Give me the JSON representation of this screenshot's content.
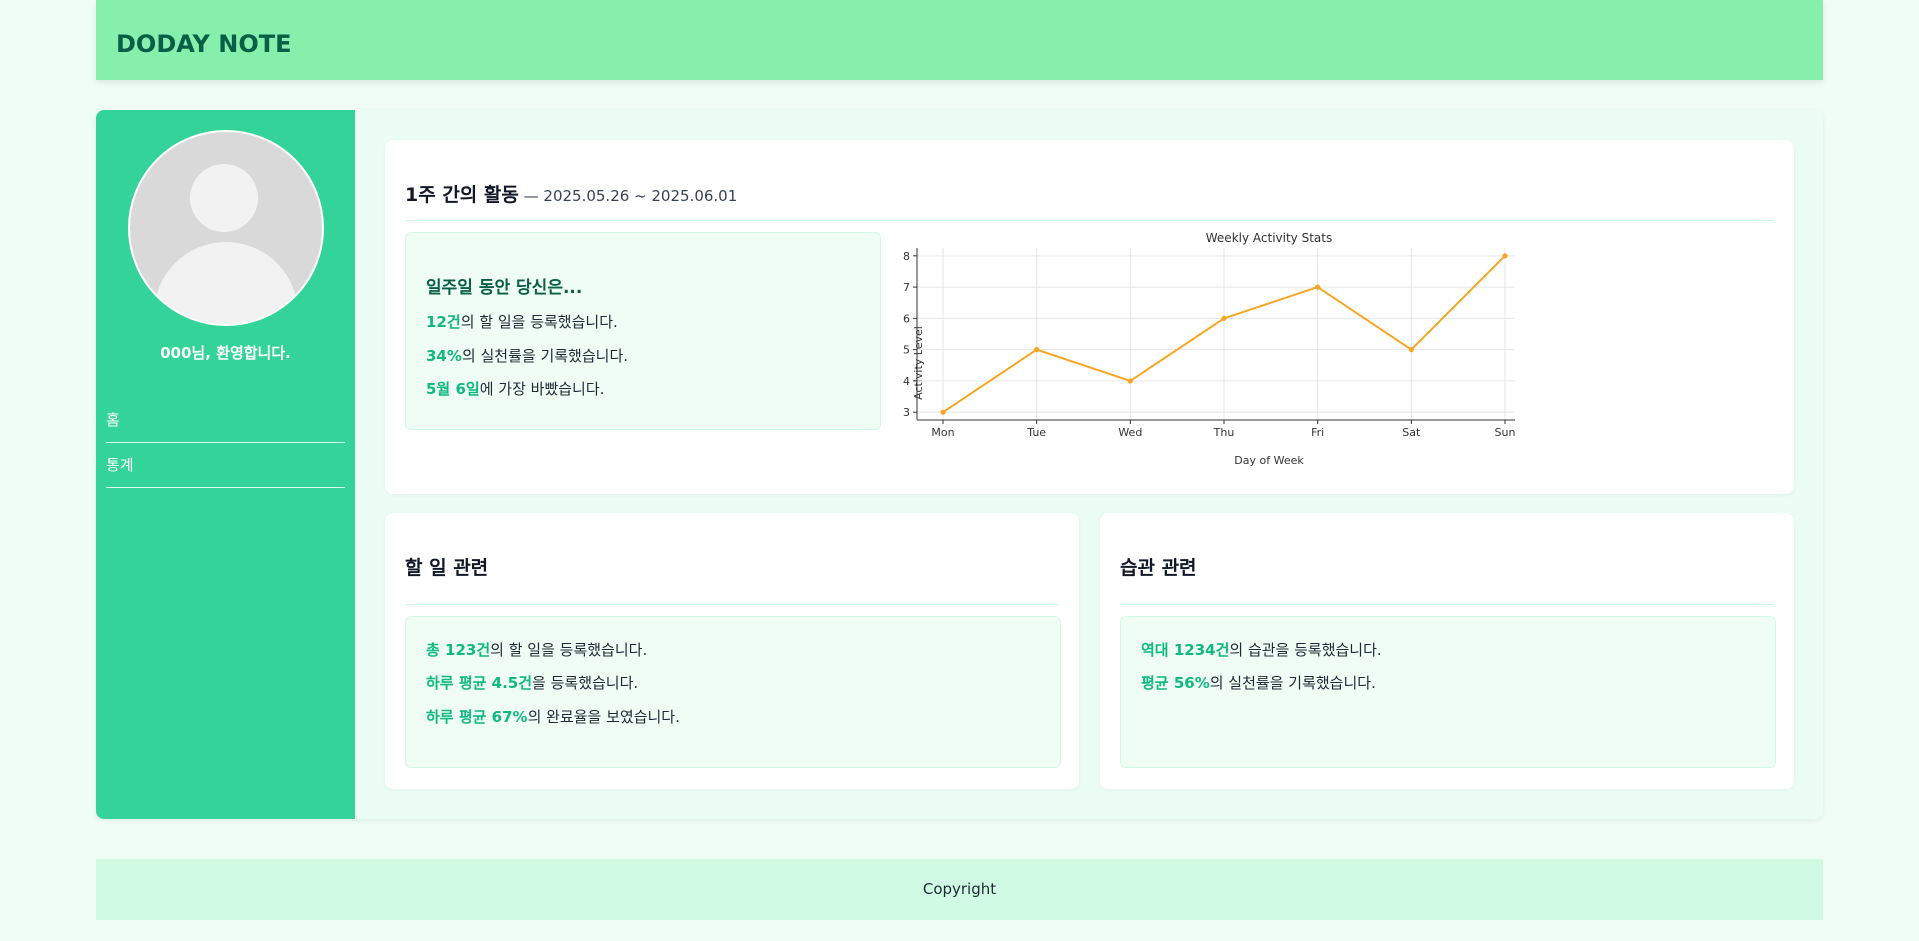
{
  "header": {
    "brand": "DODAY NOTE"
  },
  "sidebar": {
    "welcome": "000님, 환영합니다.",
    "nav": [
      {
        "label": "홈"
      },
      {
        "label": "통계"
      }
    ]
  },
  "weekly": {
    "title": "1주 간의 활동",
    "range": " — 2025.05.26 ~ 2025.06.01",
    "summary_title": "일주일 동안 당신은...",
    "lines": [
      {
        "hl": "12건",
        "rest": "의 할 일을 등록했습니다."
      },
      {
        "hl": "34%",
        "rest": "의 실천률을 기록했습니다."
      },
      {
        "hl": "5월 6일",
        "rest": "에 가장 바빴습니다."
      }
    ]
  },
  "chart_data": {
    "type": "line",
    "title": "Weekly Activity Stats",
    "xlabel": "Day of Week",
    "ylabel": "Activity Level",
    "categories": [
      "Mon",
      "Tue",
      "Wed",
      "Thu",
      "Fri",
      "Sat",
      "Sun"
    ],
    "values": [
      3,
      5,
      4,
      6,
      7,
      5,
      8
    ],
    "yticks": [
      3,
      4,
      5,
      6,
      7,
      8
    ],
    "ylim": [
      2.75,
      8.25
    ],
    "grid": true,
    "color": "#f5a623"
  },
  "todo": {
    "title": "할 일 관련",
    "lines": [
      {
        "hl": "총 123건",
        "rest": "의 할 일을 등록했습니다."
      },
      {
        "hl": "하루 평균 4.5건",
        "rest": "을 등록했습니다."
      },
      {
        "hl": "하루 평균 67%",
        "rest": "의 완료율을 보였습니다."
      }
    ]
  },
  "habit": {
    "title": "습관 관련",
    "lines": [
      {
        "hl": "역대 1234건",
        "rest": "의 습관을 등록했습니다."
      },
      {
        "hl": "평균 56%",
        "rest": "의 실천률을 기록했습니다."
      }
    ]
  },
  "footer": {
    "text": "Copyright"
  },
  "colors": {
    "header": "#86efac",
    "sidebar": "#34d399",
    "accent": "#10b981",
    "line": "#f5a623"
  }
}
